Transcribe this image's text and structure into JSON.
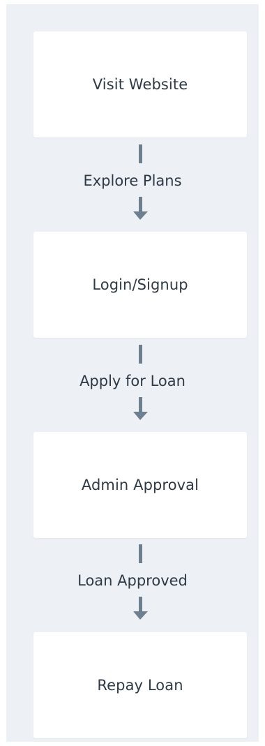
{
  "flow": {
    "steps": [
      {
        "label": "Visit Website"
      },
      {
        "label": "Login/Signup"
      },
      {
        "label": "Admin Approval"
      },
      {
        "label": "Repay Loan"
      }
    ],
    "transitions": [
      {
        "label": "Explore Plans"
      },
      {
        "label": "Apply for Loan"
      },
      {
        "label": "Loan Approved"
      }
    ]
  },
  "colors": {
    "background": "#edf1f5",
    "node_fill": "#ffffff",
    "arrow": "#6e7f90",
    "text": "#2e3a46"
  }
}
